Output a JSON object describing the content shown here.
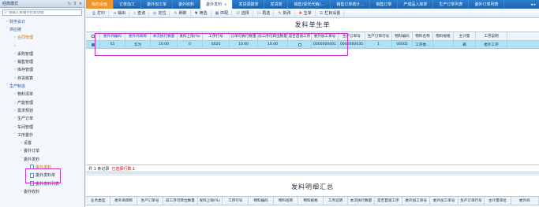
{
  "sidebar": {
    "title": "经典模式",
    "search_placeholder": "请输入关键字检索功能",
    "items": [
      {
        "label": "财务会计",
        "level": 0,
        "arrow": "›",
        "color": "blue"
      },
      {
        "label": "供应链",
        "level": 0,
        "arrow": "˅",
        "color": "blue"
      },
      {
        "label": "合同管理",
        "level": 1,
        "arrow": "›",
        "color": "orange"
      },
      {
        "label": "",
        "level": 1,
        "arrow": "›",
        "color": ""
      },
      {
        "label": "采购管理",
        "level": 1,
        "arrow": "›",
        "color": ""
      },
      {
        "label": "销售管理",
        "level": 1,
        "arrow": "›",
        "color": ""
      },
      {
        "label": "库存管理",
        "level": 1,
        "arrow": "›",
        "color": ""
      },
      {
        "label": "存货核算",
        "level": 1,
        "arrow": "›",
        "color": ""
      },
      {
        "label": "生产制造",
        "level": 0,
        "arrow": "˅",
        "color": "blue"
      },
      {
        "label": "物料清单",
        "level": 1,
        "arrow": "›",
        "color": ""
      },
      {
        "label": "产能管理",
        "level": 1,
        "arrow": "›",
        "color": ""
      },
      {
        "label": "需求规划",
        "level": 1,
        "arrow": "›",
        "color": ""
      },
      {
        "label": "生产订单",
        "level": 1,
        "arrow": "›",
        "color": ""
      },
      {
        "label": "车间管理",
        "level": 1,
        "arrow": "›",
        "color": ""
      },
      {
        "label": "工序委外",
        "level": 1,
        "arrow": "˅",
        "color": ""
      },
      {
        "label": "设置",
        "level": 2,
        "arrow": "›",
        "color": ""
      },
      {
        "label": "委外订单",
        "level": 2,
        "arrow": "›",
        "color": ""
      },
      {
        "label": "委外发料",
        "level": 2,
        "arrow": "˅",
        "color": ""
      },
      {
        "label": "委外发料",
        "level": 3,
        "arrow": "",
        "color": "",
        "selected": true
      },
      {
        "label": "委外发料单",
        "level": 3,
        "arrow": "",
        "color": ""
      },
      {
        "label": "委外发料列表",
        "level": 3,
        "arrow": "",
        "color": ""
      },
      {
        "label": "委外收料",
        "level": 2,
        "arrow": "›",
        "color": ""
      }
    ]
  },
  "tabs": [
    {
      "label": "我的桌面",
      "type": "home"
    },
    {
      "label": "订单加工",
      "type": ""
    },
    {
      "label": "委外加工单",
      "type": ""
    },
    {
      "label": "委外收料",
      "type": ""
    },
    {
      "label": "委外发料",
      "type": "active"
    },
    {
      "label": "发货调拨单",
      "type": ""
    },
    {
      "label": "发货单",
      "type": ""
    },
    {
      "label": "销售(受托代销)…",
      "type": ""
    },
    {
      "label": "销售订单统计…",
      "type": ""
    },
    {
      "label": "销售订单",
      "type": ""
    },
    {
      "label": "产成品入库单",
      "type": ""
    },
    {
      "label": "生产订单列表",
      "type": ""
    },
    {
      "label": "委外订单列表",
      "type": ""
    }
  ],
  "toolbar": [
    {
      "label": "打印",
      "icon": "print-icon",
      "glyph": "⎙",
      "cls": ""
    },
    {
      "label": "输出",
      "icon": "export-icon",
      "glyph": "⇥",
      "cls": ""
    },
    {
      "label": "查询",
      "icon": "query-icon",
      "glyph": "⌕",
      "cls": ""
    },
    {
      "label": "定位",
      "icon": "locate-icon",
      "glyph": "◎",
      "cls": ""
    },
    {
      "label": "刷新",
      "icon": "refresh-icon",
      "glyph": "↻",
      "cls": "g"
    },
    {
      "label": "筛选",
      "icon": "filter-icon",
      "glyph": "▼",
      "cls": ""
    },
    {
      "label": "匹配",
      "icon": "match-icon",
      "glyph": "▦",
      "cls": ""
    },
    {
      "label": "选择",
      "icon": "select-icon",
      "glyph": "☑",
      "cls": "g"
    },
    {
      "label": "再选",
      "icon": "reselect-icon",
      "glyph": "☐",
      "cls": ""
    },
    {
      "label": "批改",
      "icon": "batch-edit-icon",
      "glyph": "✎",
      "cls": ""
    },
    {
      "label": "生单",
      "icon": "generate-icon",
      "glyph": "✚",
      "cls": "r"
    },
    {
      "label": "栏目设置",
      "icon": "column-settings-icon",
      "glyph": "☰",
      "cls": ""
    }
  ],
  "section1": {
    "title": "发料单生单",
    "headers": [
      "",
      "委外商编码",
      "委外商简称",
      "本次执行数量",
      "发料上限(%)",
      "工序行号",
      "订单可执行数量",
      "前工序可转出数量",
      "是否首道工序",
      "委外加工单号",
      "生产订单号",
      "生产订单行号",
      "物料编码",
      "物料名称",
      "物料规格",
      "主计量",
      "工序说明"
    ],
    "highlighted_headers": [
      1,
      2,
      3
    ],
    "row": [
      "",
      "01",
      "华为",
      "10.00",
      "0",
      "0020",
      "10.00",
      "10.00",
      "",
      "0000000001",
      "0000000035",
      "1",
      "04002",
      "工序委…",
      "",
      "箱",
      "委外工序"
    ]
  },
  "status": {
    "total": "共 1 条记录",
    "selected": "已选择行数:1"
  },
  "section2": {
    "title": "发料明细汇总",
    "headers": [
      "业务类型",
      "委外商简称",
      "生产订单号",
      "前工序可转出数量",
      "发料上限(%)",
      "工序行号",
      "物料编码",
      "物料名称",
      "物料规格",
      "工序说明",
      "本次执行数量",
      "是否首道工序",
      "委外加工单号",
      "委外加工单号",
      "生产订单行号",
      "主计量单位",
      "委外商"
    ]
  }
}
